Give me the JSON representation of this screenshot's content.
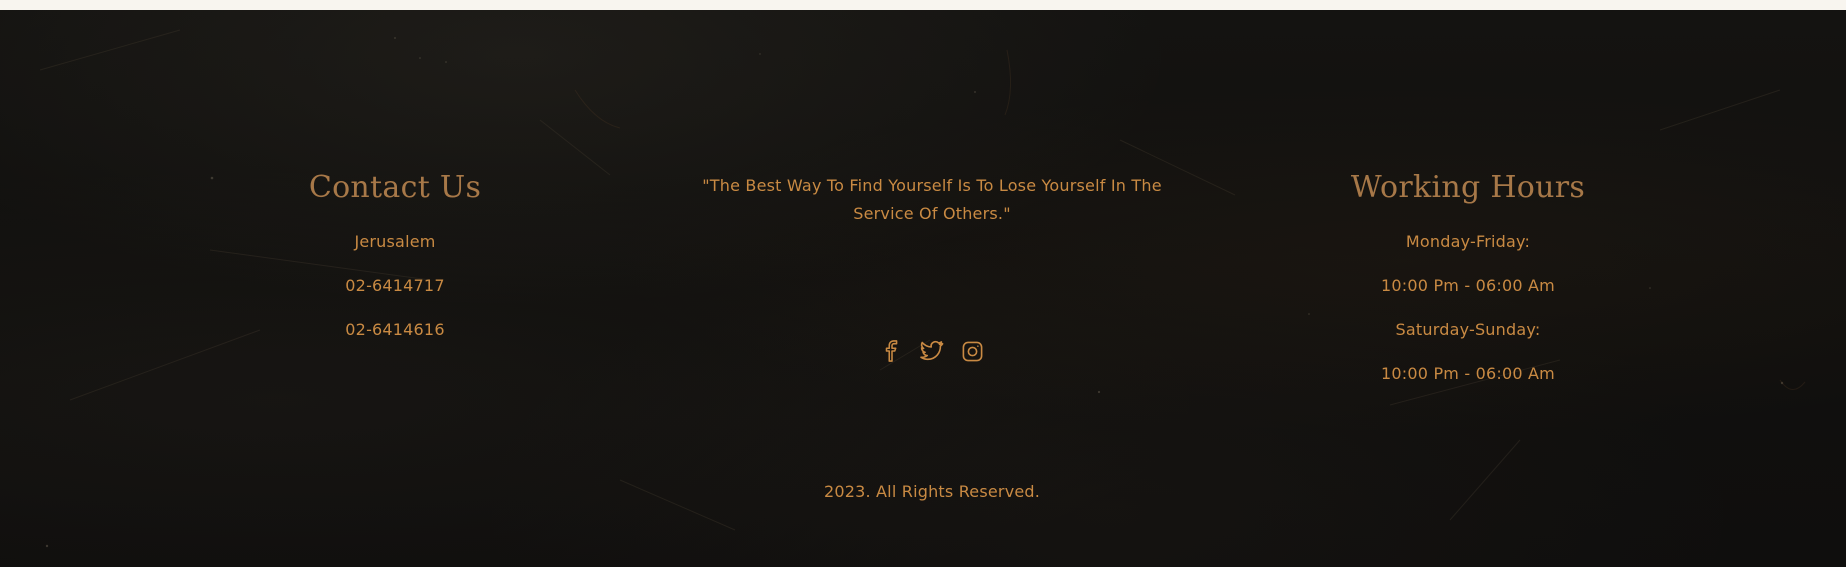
{
  "contact": {
    "title": "Contact Us",
    "city": "Jerusalem",
    "phone_1": "02-6414717",
    "phone_2": "02-6414616"
  },
  "quote": {
    "text": "\"The Best Way To Find Yourself Is To Lose Yourself In The Service Of Others.\""
  },
  "social": [
    {
      "name": "facebook-icon"
    },
    {
      "name": "twitter-icon"
    },
    {
      "name": "instagram-icon"
    }
  ],
  "hours": {
    "title": "Working Hours",
    "weekday_label": "Monday-Friday:",
    "weekday_hours": "10:00 Pm - 06:00 Am",
    "weekend_label": "Saturday-Sunday:",
    "weekend_hours": "10:00 Pm - 06:00 Am"
  },
  "copyright": "2023. All Rights Reserved.",
  "colors": {
    "accent": "#c98a43",
    "title": "#a77848",
    "background": "#121110"
  }
}
